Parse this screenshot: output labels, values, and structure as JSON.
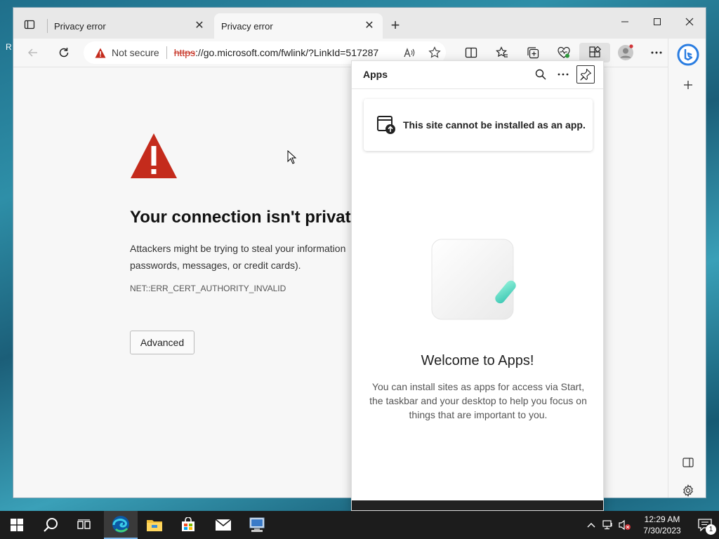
{
  "desktop": {
    "edge_text": "R"
  },
  "browser": {
    "tabs": [
      {
        "label": "Privacy error",
        "active": false
      },
      {
        "label": "Privacy error",
        "active": true
      }
    ],
    "address_bar": {
      "security_label": "Not secure",
      "url_scheme": "https",
      "url_rest": "://go.microsoft.com/fwlink/?LinkId=517287"
    }
  },
  "error_page": {
    "title": "Your connection isn't private",
    "body": "Attackers might be trying to steal your information from go.microsoft.com (for example, passwords, messages, or credit cards).",
    "body_visible": "Attackers might be trying to steal your information",
    "body_line2": "passwords, messages, or credit cards).",
    "error_code": "NET::ERR_CERT_AUTHORITY_INVALID",
    "advanced_label": "Advanced"
  },
  "apps_panel": {
    "title": "Apps",
    "cannot_install": "This site cannot be installed as an app.",
    "welcome_title": "Welcome to Apps!",
    "welcome_body": "You can install sites as apps for access via Start, the taskbar and your desktop to help you focus on things that are important to you."
  },
  "taskbar": {
    "time": "12:29 AM",
    "date": "7/30/2023",
    "notification_count": "1"
  },
  "colors": {
    "warning_red": "#c42b1c",
    "accent": "#0078d4"
  }
}
